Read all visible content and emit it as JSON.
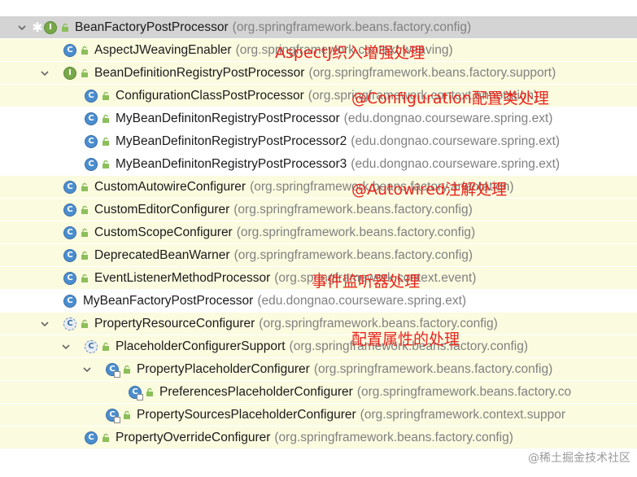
{
  "tree": {
    "rows": [
      {
        "name": "BeanFactoryPostProcessor",
        "pkg": "(org.springframework.beans.factory.config)",
        "icon": "I",
        "arrow": "down",
        "star": true
      },
      {
        "name": "AspectJWeavingEnabler",
        "pkg": "(org.springframework.context.weaving)",
        "icon": "C"
      },
      {
        "name": "BeanDefinitionRegistryPostProcessor",
        "pkg": "(org.springframework.beans.factory.support)",
        "icon": "I",
        "arrow": "down"
      },
      {
        "name": "ConfigurationClassPostProcessor",
        "pkg": "(org.springframework.context.annotation)",
        "icon": "C"
      },
      {
        "name": "MyBeanDefinitonRegistryPostProcessor",
        "pkg": "(edu.dongnao.courseware.spring.ext)",
        "icon": "C"
      },
      {
        "name": "MyBeanDefinitonRegistryPostProcessor2",
        "pkg": "(edu.dongnao.courseware.spring.ext)",
        "icon": "C"
      },
      {
        "name": "MyBeanDefinitonRegistryPostProcessor3",
        "pkg": "(edu.dongnao.courseware.spring.ext)",
        "icon": "C"
      },
      {
        "name": "CustomAutowireConfigurer",
        "pkg": "(org.springframework.beans.factory.annotation)",
        "icon": "C"
      },
      {
        "name": "CustomEditorConfigurer",
        "pkg": "(org.springframework.beans.factory.config)",
        "icon": "C"
      },
      {
        "name": "CustomScopeConfigurer",
        "pkg": "(org.springframework.beans.factory.config)",
        "icon": "C"
      },
      {
        "name": "DeprecatedBeanWarner",
        "pkg": "(org.springframework.beans.factory.config)",
        "icon": "C"
      },
      {
        "name": "EventListenerMethodProcessor",
        "pkg": "(org.springframework.context.event)",
        "icon": "C"
      },
      {
        "name": "MyBeanFactoryPostProcessor",
        "pkg": "(edu.dongnao.courseware.spring.ext)",
        "icon": "C"
      },
      {
        "name": "PropertyResourceConfigurer",
        "pkg": "(org.springframework.beans.factory.config)",
        "icon": "C",
        "arrow": "down"
      },
      {
        "name": "PlaceholderConfigurerSupport",
        "pkg": "(org.springframework.beans.factory.config)",
        "icon": "C",
        "arrow": "down"
      },
      {
        "name": "PropertyPlaceholderConfigurer",
        "pkg": "(org.springframework.beans.factory.config)",
        "icon": "C",
        "arrow": "down"
      },
      {
        "name": "PreferencesPlaceholderConfigurer",
        "pkg": "(org.springframework.beans.factory.co",
        "icon": "C"
      },
      {
        "name": "PropertySourcesPlaceholderConfigurer",
        "pkg": "(org.springframework.context.suppor",
        "icon": "C"
      },
      {
        "name": "PropertyOverrideConfigurer",
        "pkg": "(org.springframework.beans.factory.config)",
        "icon": "C"
      }
    ]
  },
  "annotations": [
    "AspectJ织入增强处理",
    "@Configuration配置类处理",
    "@Autowired注解处理",
    "事件监听器处理",
    "配置属性的处理"
  ],
  "watermark": "@稀土掘金技术社区",
  "colors": {
    "annotation": "#e8261f",
    "package_text": "#808080",
    "selected_row": "#d4d4d4",
    "highlight_row": "#fbfbe0"
  }
}
